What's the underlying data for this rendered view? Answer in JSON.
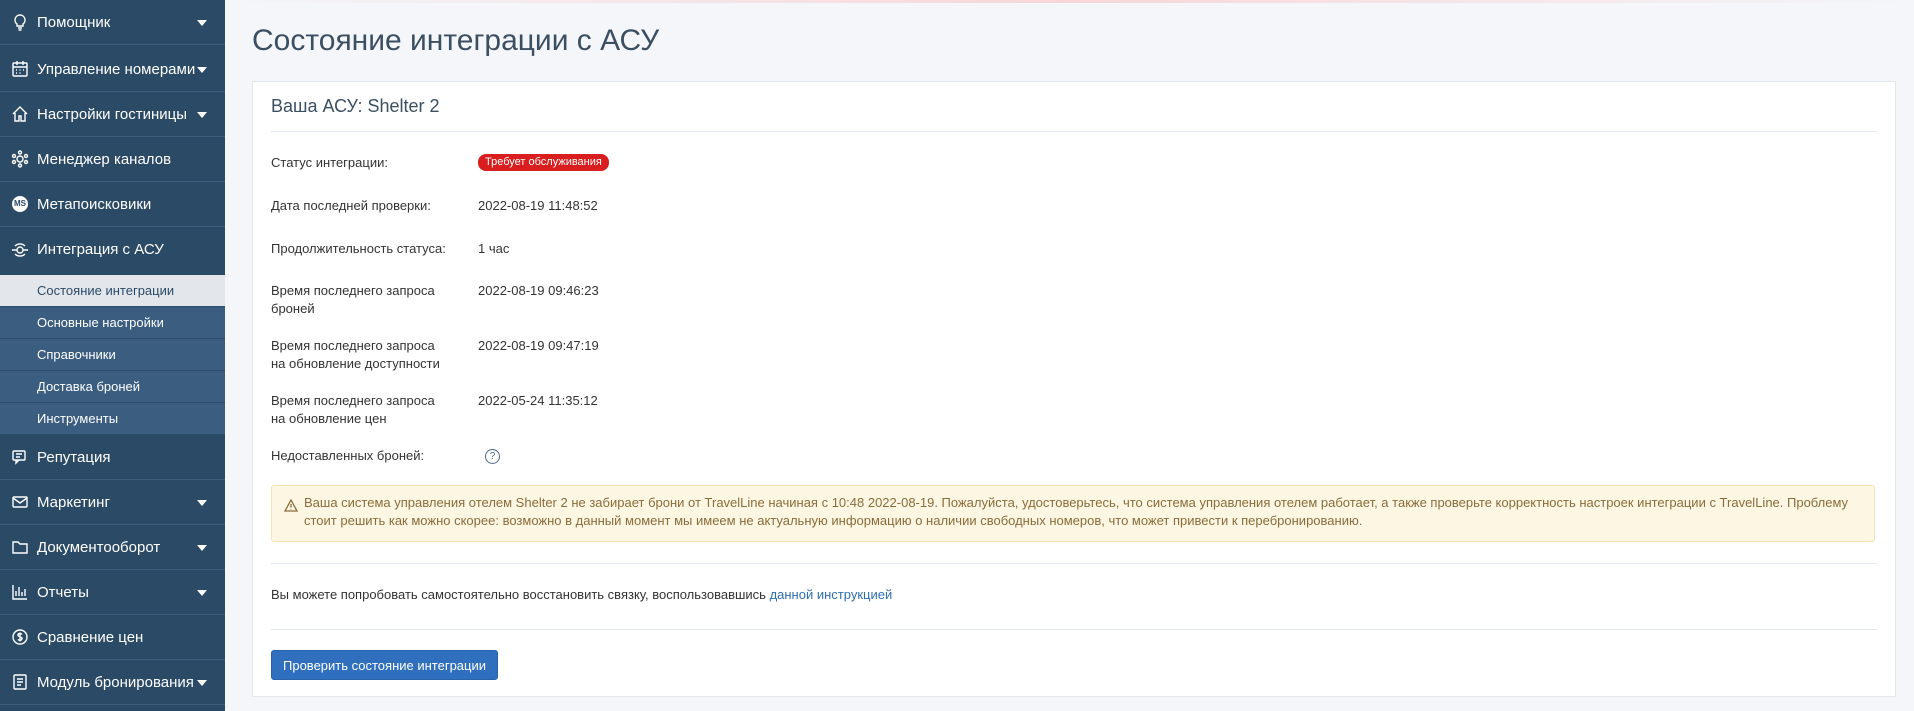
{
  "sidebar": {
    "items": [
      {
        "label": "Помощник",
        "icon": "lightbulb-icon",
        "expandable": true
      },
      {
        "label": "Управление номерами",
        "icon": "calendar-icon",
        "expandable": true
      },
      {
        "label": "Настройки гостиницы",
        "icon": "home-icon",
        "expandable": true
      },
      {
        "label": "Менеджер каналов",
        "icon": "gear-network-icon",
        "expandable": false
      },
      {
        "label": "Метапоисковики",
        "icon": "ms-badge-icon",
        "icon_text": "MS",
        "expandable": false
      },
      {
        "label": "Интеграция с АСУ",
        "icon": "integration-icon",
        "expandable": false
      }
    ],
    "subitems": [
      {
        "label": "Состояние интеграции",
        "active": true
      },
      {
        "label": "Основные настройки",
        "active": false
      },
      {
        "label": "Справочники",
        "active": false
      },
      {
        "label": "Доставка броней",
        "active": false
      },
      {
        "label": "Инструменты",
        "active": false
      }
    ],
    "items_after": [
      {
        "label": "Репутация",
        "icon": "chat-icon",
        "expandable": false
      },
      {
        "label": "Маркетинг",
        "icon": "envelope-icon",
        "expandable": true
      },
      {
        "label": "Документооборот",
        "icon": "folder-icon",
        "expandable": true
      },
      {
        "label": "Отчеты",
        "icon": "bar-chart-icon",
        "expandable": true
      },
      {
        "label": "Сравнение цен",
        "icon": "price-compare-icon",
        "expandable": false
      },
      {
        "label": "Модуль бронирования",
        "icon": "booking-icon",
        "expandable": true
      }
    ]
  },
  "page": {
    "title": "Состояние интеграции с АСУ"
  },
  "card": {
    "title": "Ваша АСУ: Shelter 2",
    "status_label": "Статус интеграции:",
    "status_badge": "Требует обслуживания",
    "last_check_label": "Дата последней проверки:",
    "last_check_value": "2022-08-19 11:48:52",
    "duration_label": "Продолжительность статуса:",
    "duration_value": "1 час",
    "last_bookings_label_1": "Время последнего запроса",
    "last_bookings_label_2": "броней",
    "last_bookings_value": "2022-08-19 09:46:23",
    "last_avail_label_1": "Время последнего запроса",
    "last_avail_label_2": "на обновление доступности",
    "last_avail_value": "2022-08-19 09:47:19",
    "last_prices_label_1": "Время последнего запроса",
    "last_prices_label_2": "на обновление цен",
    "last_prices_value": "2022-05-24 11:35:12",
    "undelivered_label": "Недоставленных броней:",
    "help_glyph": "?",
    "alert_text_1": "Ваша система управления отелем Shelter 2 не забирает брони от TravelLine начиная с 10:48 2022-08-19. Пожалуйста, удостоверьтесь, что система управления отелем работает, а также проверьте корректность настроек интеграции с TravelLine. Проблему",
    "alert_text_2": "стоит решить как можно скорее: возможно в данный момент мы имеем не актуальную информацию о наличии свободных номеров, что может привести к перебронированию.",
    "restore_text": "Вы можете попробовать самостоятельно восстановить связку, воспользовавшись ",
    "restore_link": "данной инструкцией",
    "check_button": "Проверить состояние интеграции"
  },
  "colors": {
    "sidebar_bg": "#2b4a66",
    "sub_bg": "#3a5d80",
    "badge_red": "#d81e1e",
    "primary_button": "#2f6fbd",
    "alert_bg": "#fcf6e3",
    "link": "#2e6fb3"
  }
}
